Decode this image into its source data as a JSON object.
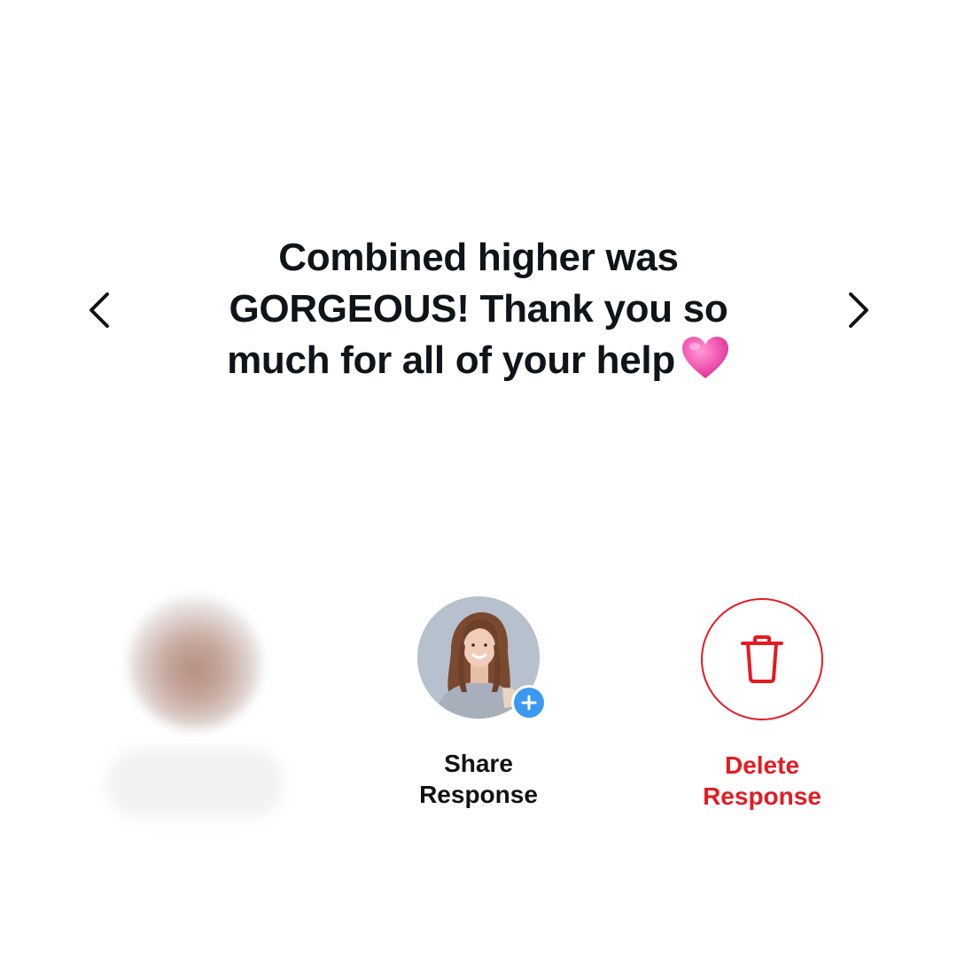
{
  "message": {
    "lines": [
      "Combined higher was",
      "GORGEOUS! Thank you so",
      "much for all of your help"
    ],
    "emoji": "heart-emoji"
  },
  "navigation": {
    "prev_icon": "chevron-left-icon",
    "next_icon": "chevron-right-icon"
  },
  "actions": {
    "share": {
      "label_line1": "Share",
      "label_line2": "Response",
      "badge_icon": "plus-icon"
    },
    "delete": {
      "label_line1": "Delete",
      "label_line2": "Response",
      "icon": "trash-icon"
    }
  },
  "colors": {
    "text": "#0f1419",
    "delete": "#e31b23",
    "badge": "#3b9aef",
    "heart": "#f25bb4"
  }
}
